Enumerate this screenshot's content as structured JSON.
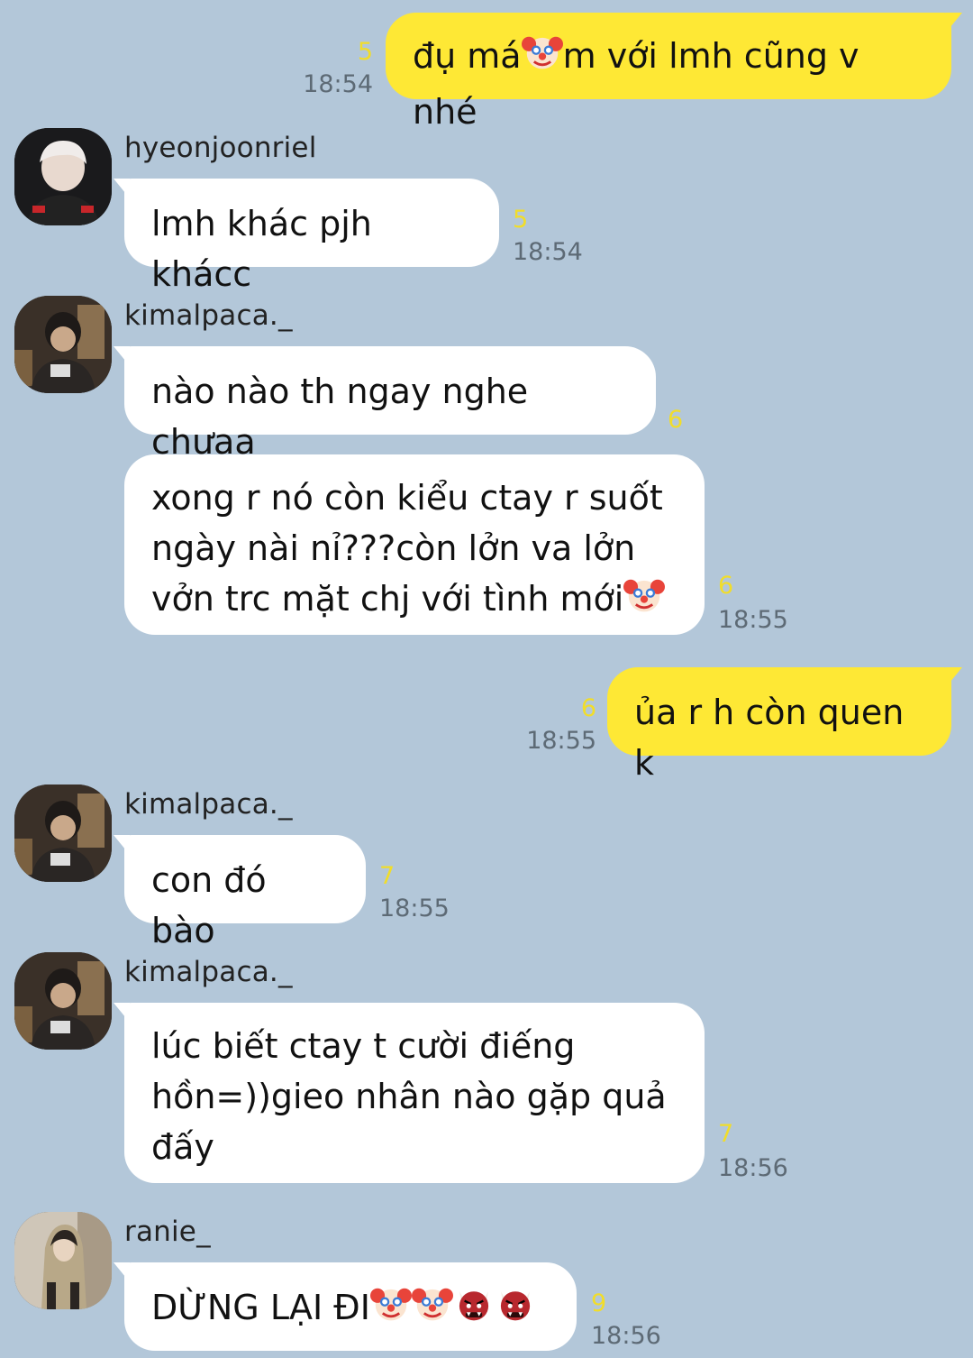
{
  "messages": [
    {
      "sender": "",
      "mine": true,
      "text_pre": "đụ má",
      "emoji_mid": "clown-face",
      "text_post": "m với lmh cũng v nhé",
      "unread": "5",
      "time": "18:54"
    },
    {
      "sender": "hyeonjoonriel",
      "mine": false,
      "text": "lmh khác pjh khácc",
      "unread": "5",
      "time": "18:54"
    },
    {
      "sender": "kimalpaca._",
      "mine": false,
      "text": "nào nào th ngay nghe chưaa",
      "unread": "6",
      "time": ""
    },
    {
      "sender": "",
      "mine": false,
      "lines": [
        "xong r nó còn kiểu ctay r suốt",
        "ngày nài nỉ???còn lởn va lởn",
        "vởn trc mặt chj với tình mới"
      ],
      "emoji_end": "clown-face",
      "unread": "6",
      "time": "18:55"
    },
    {
      "sender": "",
      "mine": true,
      "text": "ủa r h còn quen k",
      "unread": "6",
      "time": "18:55"
    },
    {
      "sender": "kimalpaca._",
      "mine": false,
      "text": "con đó bào",
      "unread": "7",
      "time": "18:55"
    },
    {
      "sender": "kimalpaca._",
      "mine": false,
      "lines": [
        "lúc biết ctay t cười điếng",
        "hồn=))gieo nhân nào gặp quả",
        "đấy"
      ],
      "unread": "7",
      "time": "18:56"
    },
    {
      "sender": "ranie_",
      "mine": false,
      "text": "DỪNG LẠI ĐI",
      "emojis_end": [
        "clown-face",
        "clown-face",
        "ogre-face",
        "ogre-face"
      ],
      "unread": "9",
      "time": "18:56"
    }
  ],
  "colors": {
    "background": "#b3c7d9",
    "my_bubble": "#fee835",
    "their_bubble": "#ffffff",
    "unread_count": "#f1dd2a",
    "time": "#5d6a75"
  }
}
